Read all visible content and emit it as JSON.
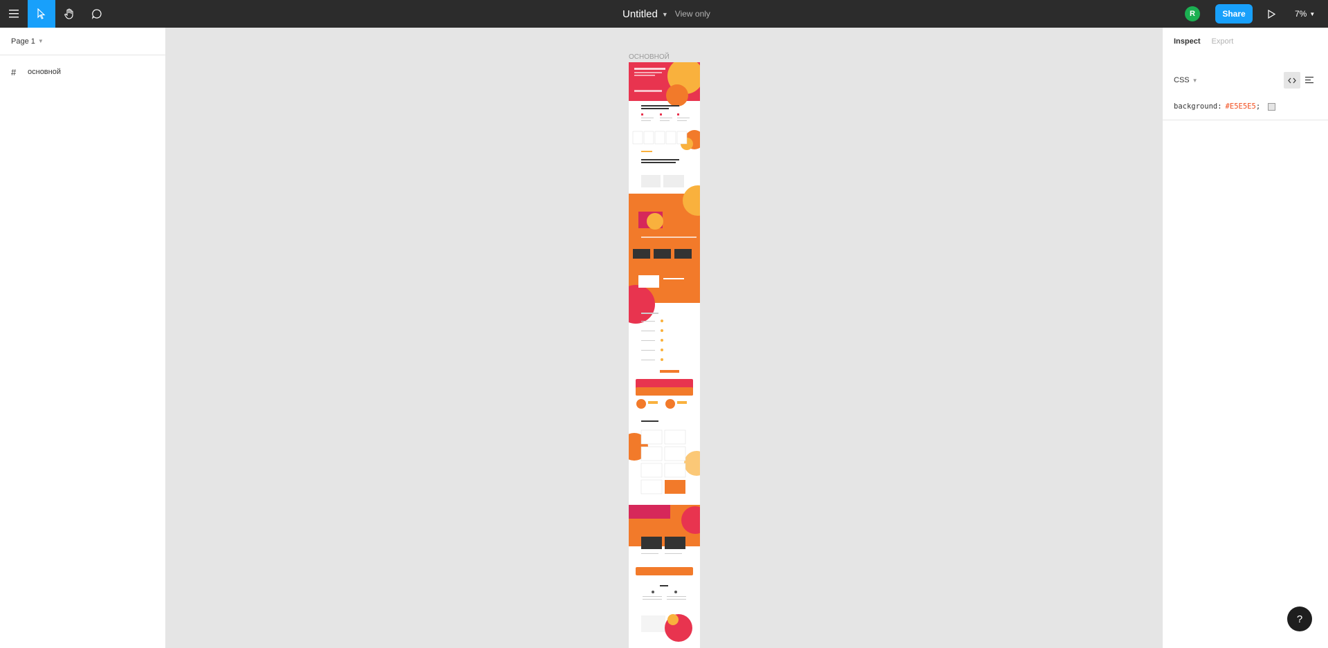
{
  "toolbar": {
    "file_name": "Untitled",
    "view_mode": "View only",
    "avatar_initial": "R",
    "share_label": "Share",
    "zoom_level": "7%"
  },
  "left_panel": {
    "page_selector": "Page 1",
    "layers": [
      {
        "label": "основной",
        "icon": "frame-hash-icon"
      }
    ]
  },
  "canvas": {
    "frame_label": "ОСНОВНОЙ",
    "background": "#E5E5E5"
  },
  "right_panel": {
    "tabs": [
      "Inspect",
      "Export"
    ],
    "code_language": "CSS",
    "css_property": "background:",
    "css_value": "#E5E5E5",
    "css_terminator": ";"
  },
  "colors": {
    "accent": "#18A0FB",
    "toolbar_bg": "#2C2C2C",
    "avatar_green": "#1BB052",
    "brand_orange": "#F27A2A",
    "brand_magenta": "#D6285A"
  },
  "help_label": "?"
}
